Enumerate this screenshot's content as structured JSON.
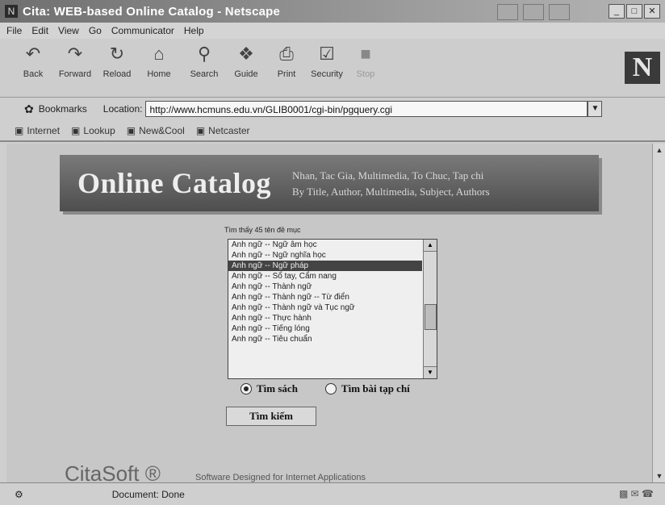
{
  "window": {
    "title": "Cita: WEB-based Online Catalog - Netscape",
    "controls": [
      "_",
      "□",
      "✕"
    ]
  },
  "menu": [
    "File",
    "Edit",
    "View",
    "Go",
    "Communicator",
    "Help"
  ],
  "toolbar": {
    "buttons": [
      {
        "label": "Back",
        "icon": "back-arrow-icon"
      },
      {
        "label": "Forward",
        "icon": "forward-arrow-icon"
      },
      {
        "label": "Reload",
        "icon": "reload-icon"
      },
      {
        "label": "Home",
        "icon": "home-icon"
      },
      {
        "label": "Search",
        "icon": "search-icon"
      },
      {
        "label": "Guide",
        "icon": "guide-icon"
      },
      {
        "label": "Print",
        "icon": "print-icon"
      },
      {
        "label": "Security",
        "icon": "security-icon"
      },
      {
        "label": "Stop",
        "icon": "stop-icon"
      }
    ],
    "logo": "N"
  },
  "location": {
    "bookmarks_label": "Bookmarks",
    "location_label": "Location:",
    "url": "http://www.hcmuns.edu.vn/GLIB0001/cgi-bin/pgquery.cgi"
  },
  "personal": [
    "Internet",
    "Lookup",
    "New&Cool",
    "Netcaster"
  ],
  "page": {
    "banner_title": "Online Catalog",
    "banner_sub1": "Nhan, Tac Gia, Multimedia, To Chuc, Tap chi",
    "banner_sub2": "By Title, Author, Multimedia, Subject, Authors",
    "list_label": "Tìm thấy 45 tên đề mục",
    "list_items": [
      "Anh ngữ -- Ngữ âm học",
      "Anh ngữ -- Ngữ nghĩa học",
      "Anh ngữ -- Ngữ pháp",
      "Anh ngữ -- Sổ tay, Cẩm nang",
      "Anh ngữ -- Thành ngữ",
      "Anh ngữ -- Thành ngữ -- Từ điển",
      "Anh ngữ -- Thành ngữ và Tục ngữ",
      "Anh ngữ -- Thực hành",
      "Anh ngữ -- Tiếng lóng",
      "Anh ngữ -- Tiêu chuẩn"
    ],
    "selected_index": 2,
    "radio_books": "Tìm sách",
    "radio_journals": "Tìm bài tạp chí",
    "search_button": "Tìm kiếm",
    "footer_logo": "CitaSoft ®",
    "footer_text": "Software Designed for Internet Applications"
  },
  "status": {
    "text": "Document: Done"
  }
}
